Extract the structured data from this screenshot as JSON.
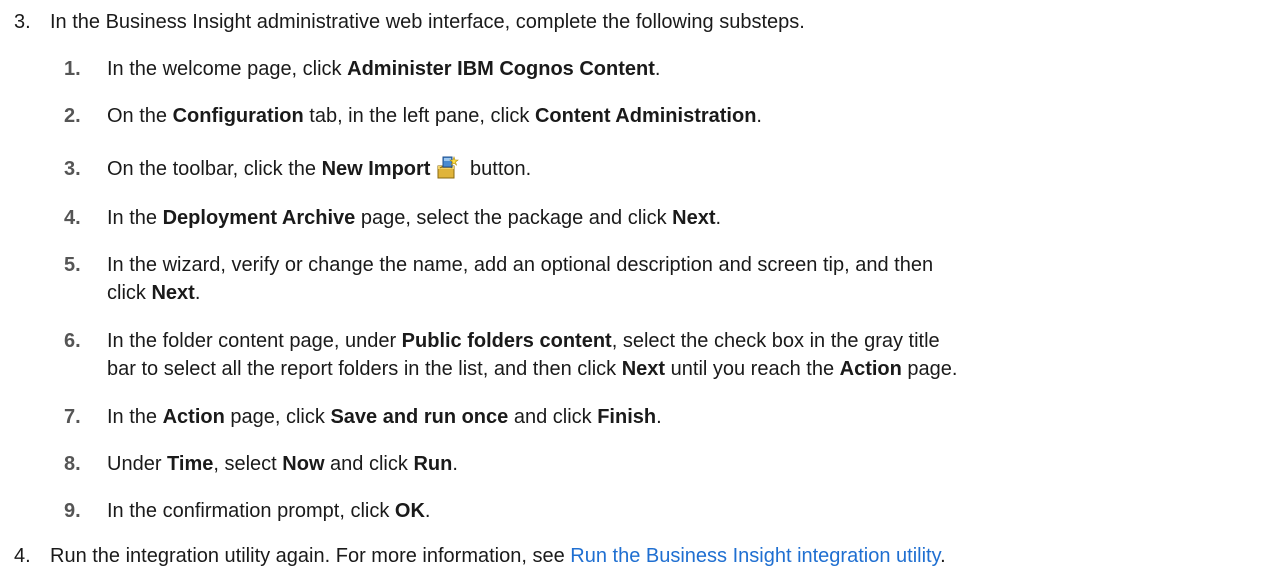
{
  "step3": {
    "number": "3.",
    "text": "In the Business Insight administrative web interface, complete the following substeps."
  },
  "substeps": [
    {
      "number": "1.",
      "pre": "In the welcome page, click ",
      "b1": "Administer IBM Cognos Content",
      "post": "."
    },
    {
      "number": "2.",
      "pre": "On the ",
      "b1": "Configuration",
      "mid": " tab, in the left pane, click ",
      "b2": "Content Administration",
      "post": "."
    },
    {
      "number": "3.",
      "pre": "On the toolbar, click the ",
      "b1": "New Import",
      "post": " button.",
      "icon": "new-import-icon"
    },
    {
      "number": "4.",
      "pre": "In the ",
      "b1": "Deployment Archive",
      "mid": " page, select the package and click ",
      "b2": "Next",
      "post": "."
    },
    {
      "number": "5.",
      "line1": "In the wizard, verify or change the name, add an optional description and screen tip, and then",
      "pre": "click ",
      "b1": "Next",
      "post": "."
    },
    {
      "number": "6.",
      "pre": "In the folder content page, under ",
      "b1": "Public folders content",
      "mid": ", select the check box in the gray title",
      "line2pre": "bar to select all the report folders in the list, and then click ",
      "b2": "Next",
      "mid2": " until you reach the ",
      "b3": "Action",
      "post": " page."
    },
    {
      "number": "7.",
      "pre": "In the ",
      "b1": "Action",
      "mid": " page, click ",
      "b2": "Save and run once",
      "mid2": " and click ",
      "b3": "Finish",
      "post": "."
    },
    {
      "number": "8.",
      "pre": "Under ",
      "b1": "Time",
      "mid": ", select ",
      "b2": "Now",
      "mid2": " and click ",
      "b3": "Run",
      "post": "."
    },
    {
      "number": "9.",
      "pre": "In the confirmation prompt, click ",
      "b1": "OK",
      "post": "."
    }
  ],
  "step4": {
    "number": "4.",
    "text": "Run the integration utility again. For more information, see ",
    "link": "Run the Business Insight integration utility",
    "post": "."
  }
}
